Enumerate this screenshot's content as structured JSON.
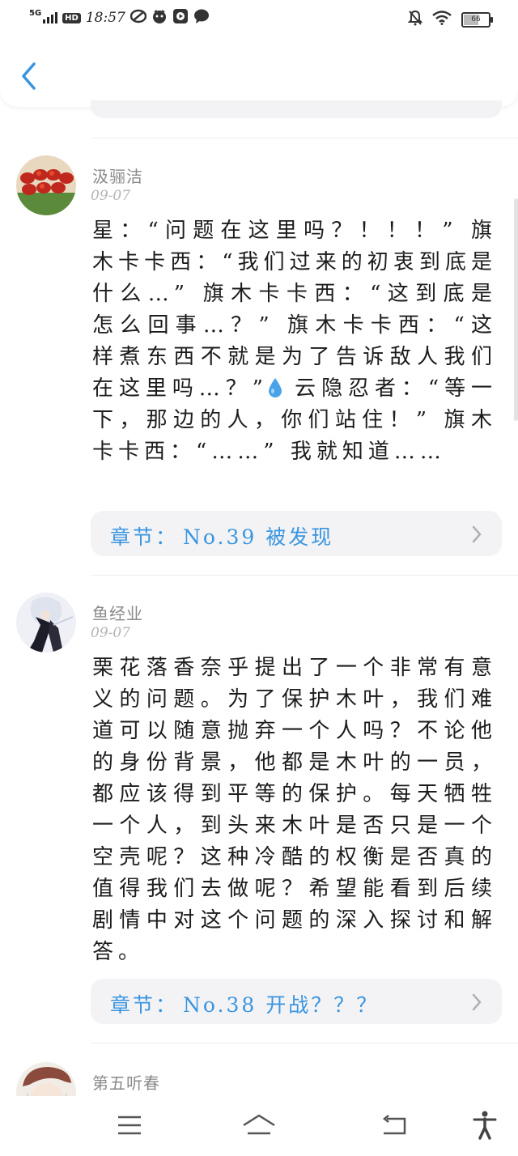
{
  "status_bar": {
    "network": "5G",
    "hd": "HD",
    "time": "18:57",
    "battery": "66",
    "battery_level": 0.66
  },
  "header": {
    "back_icon": "chevron-left-icon"
  },
  "comments": [
    {
      "username": "汲骊洁",
      "date": "09-07",
      "text_before_icon": "星：“问题在这里吗？！！！” 旗木卡卡西：“我们过来的初衷到底是什么…” 旗木卡卡西：“这到底是怎么回事…？” 旗木卡卡西：“这样煮东西不就是为了告诉敌人我们在这里吗…？”",
      "text_after_icon": "云隐忍者：“等一下，那边的人，你们站住！” 旗木卡卡西：“……” 我就知道……",
      "inline_icon": "water-drop-icon",
      "chapter_prefix": "章节：",
      "chapter_title": "No.39 被发现"
    },
    {
      "username": "鱼经业",
      "date": "09-07",
      "text": "栗花落香奈乎提出了一个非常有意义的问题。为了保护木叶，我们难道可以随意抛弃一个人吗？不论他的身份背景，他都是木叶的一员，都应该得到平等的保护。每天牺牲一个人，到头来木叶是否只是一个空壳呢？这种冷酷的权衡是否真的值得我们去做呢？希望能看到后续剧情中对这个问题的深入探讨和解答。",
      "chapter_prefix": "章节：",
      "chapter_title": "No.38 开战？？？"
    },
    {
      "username": "第五听春"
    }
  ],
  "nav": {
    "menu_icon": "menu-icon",
    "home_icon": "home-icon",
    "back_icon": "back-arrow-icon",
    "accessibility_icon": "accessibility-icon"
  }
}
